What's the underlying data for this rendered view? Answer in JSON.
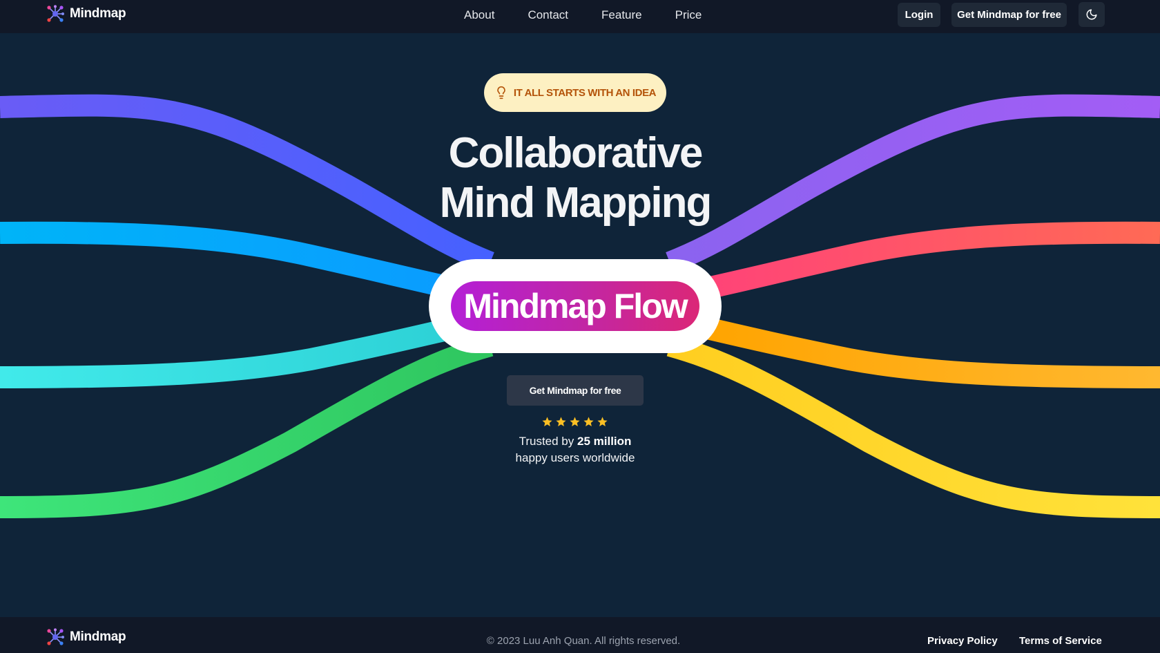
{
  "brand": {
    "name": "Mindmap",
    "icon": "network-logo-icon"
  },
  "nav": {
    "links": [
      "About",
      "Contact",
      "Feature",
      "Price"
    ],
    "login_label": "Login",
    "cta_label": "Get Mindmap for free",
    "theme_icon": "moon-icon"
  },
  "hero": {
    "badge_icon": "lightbulb-icon",
    "badge_text": "IT ALL STARTS WITH AN IDEA",
    "title_line1": "Collaborative",
    "title_line2": "Mind Mapping",
    "flow_text": "Mindmap Flow",
    "cta_label": "Get Mindmap for free",
    "rating_stars": 5,
    "trust_prefix": "Trusted by",
    "trust_highlight": "25 million",
    "trust_suffix": "happy users worldwide"
  },
  "colors": {
    "background": "#0f2439",
    "navbar": "#111827",
    "accent_pill": "#fdf0c2",
    "accent_text": "#b45309",
    "flow_start": "#b41fd6",
    "flow_end": "#db2777",
    "star": "#fbbf24",
    "ribbons": [
      "#6a5cf6",
      "#00b4f8",
      "#3ee6e6",
      "#3ddc6f",
      "#a35df5",
      "#ff5f6d",
      "#ffae1c",
      "#ffd92b"
    ]
  },
  "footer": {
    "brand": "Mindmap",
    "copyright": "© 2023 Luu Anh Quan. All rights reserved.",
    "privacy_label": "Privacy Policy",
    "terms_label": "Terms of Service"
  }
}
